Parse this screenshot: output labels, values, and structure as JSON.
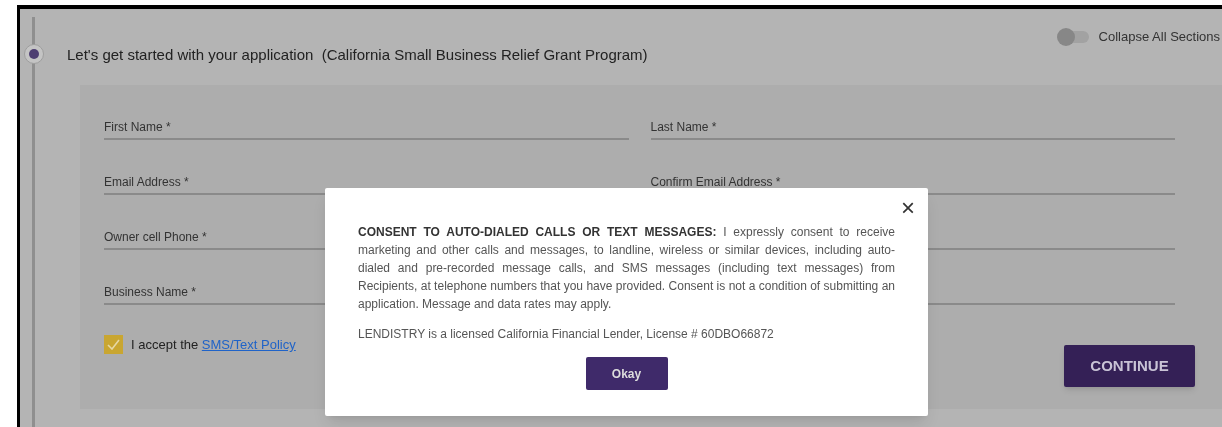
{
  "section": {
    "title": "Let's get started with your application  (California Small Business Relief Grant Program)",
    "collapse_toggle": {
      "label": "Collapse All Sections",
      "on": false
    }
  },
  "form": {
    "fields": [
      {
        "kind": "field",
        "label": "First Name *"
      },
      {
        "kind": "field",
        "label": "Last Name *"
      },
      {
        "kind": "field",
        "label": "Email Address *"
      },
      {
        "kind": "field",
        "label": "Confirm Email Address *"
      },
      {
        "kind": "field",
        "label": "Owner cell Phone *"
      },
      {
        "kind": "field"
      },
      {
        "kind": "field",
        "label": "Business Name *"
      },
      {
        "kind": "field"
      }
    ],
    "accept": {
      "text": "I accept the",
      "link": "SMS/Text Policy",
      "checked": true
    },
    "continue_button": "CONTINUE"
  },
  "dialog": {
    "close": "×",
    "paragraphs": [
      "**CONSENT TO AUTO-DIALED CALLS OR TEXT MESSAGES:** I expressly consent to receive marketing and other calls and messages, to landline, wireless or similar devices, including auto-dialed and pre-recorded message calls, and SMS messages (including text messages) from Recipients, at telephone numbers that you have provided. Consent is not a condition of submitting an application. Message and data rates may apply.",
      "LENDISTRY is a licensed California Financial Lender, License # 60DBO66872"
    ],
    "ok_button": "Okay"
  }
}
